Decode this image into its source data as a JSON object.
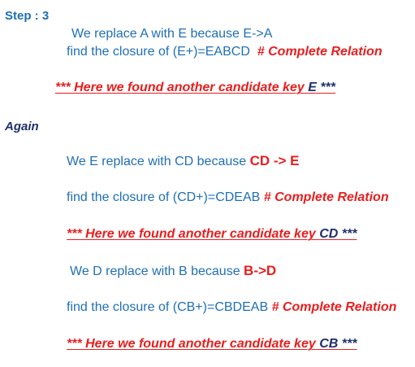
{
  "step_label": "Step : 3",
  "block1": {
    "replace_line": "We replace A with E because E->A",
    "closure_text": "find the closure of (E+)=EABCD",
    "closure_note": "# Complete Relation",
    "found_prefix": "*** Here we found  another candidate key",
    "found_key": "E",
    "found_suffix": "***"
  },
  "again_label": "Again",
  "block2": {
    "replace_text": "We E replace with CD because",
    "replace_rule": "CD -> E",
    "closure_text": "find the closure of (CD+)=CDEAB",
    "closure_note": "# Complete Relation",
    "found_prefix": "*** Here we found  another candidate key",
    "found_key": "CD",
    "found_suffix": "***"
  },
  "block3": {
    "replace_text": "We D replace with B because",
    "replace_rule": "B->D",
    "closure_text": "find the closure of (CB+)=CBDEAB",
    "closure_note": "# Complete Relation",
    "found_prefix": "*** Here we found  another candidate key",
    "found_key": "CB",
    "found_suffix": "***"
  }
}
